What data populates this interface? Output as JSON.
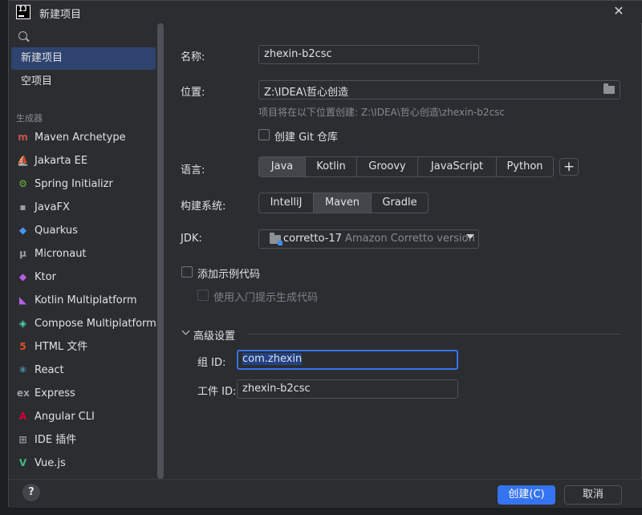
{
  "window": {
    "title": "新建项目"
  },
  "sidebar": {
    "top_items": [
      {
        "label": "新建项目",
        "selected": true
      },
      {
        "label": "空项目",
        "selected": false
      }
    ],
    "group_label": "生成器",
    "generators": [
      {
        "label": "Maven Archetype",
        "icon": "maven-icon",
        "glyph": "m",
        "color": "#c75450"
      },
      {
        "label": "Jakarta EE",
        "icon": "jakarta-icon",
        "glyph": "⛵",
        "color": "#f2a22e"
      },
      {
        "label": "Spring Initializr",
        "icon": "spring-icon",
        "glyph": "⚙",
        "color": "#6db33f"
      },
      {
        "label": "JavaFX",
        "icon": "javafx-icon",
        "glyph": "▪",
        "color": "#9aa0a8"
      },
      {
        "label": "Quarkus",
        "icon": "quarkus-icon",
        "glyph": "◆",
        "color": "#4695eb"
      },
      {
        "label": "Micronaut",
        "icon": "micronaut-icon",
        "glyph": "μ",
        "color": "#9aa0a8"
      },
      {
        "label": "Ktor",
        "icon": "ktor-icon",
        "glyph": "◆",
        "color": "#b95ee8"
      },
      {
        "label": "Kotlin Multiplatform",
        "icon": "kotlin-icon",
        "glyph": "◣",
        "color": "#b95ee8"
      },
      {
        "label": "Compose Multiplatform",
        "icon": "compose-icon",
        "glyph": "◈",
        "color": "#4dd0b0"
      },
      {
        "label": "HTML 文件",
        "icon": "html-icon",
        "glyph": "5",
        "color": "#e44d26"
      },
      {
        "label": "React",
        "icon": "react-icon",
        "glyph": "⚛",
        "color": "#61dafb"
      },
      {
        "label": "Express",
        "icon": "express-icon",
        "glyph": "ex",
        "color": "#9aa0a8"
      },
      {
        "label": "Angular CLI",
        "icon": "angular-icon",
        "glyph": "A",
        "color": "#dd0031"
      },
      {
        "label": "IDE 插件",
        "icon": "plugin-icon",
        "glyph": "⊞",
        "color": "#9aa0a8"
      },
      {
        "label": "Vue.js",
        "icon": "vue-icon",
        "glyph": "V",
        "color": "#42b883"
      }
    ]
  },
  "form": {
    "name_label": "名称:",
    "name_value": "zhexin-b2csc",
    "location_label": "位置:",
    "location_value": "Z:\\IDEA\\哲心创造",
    "location_hint": "项目将在以下位置创建: Z:\\IDEA\\哲心创造\\zhexin-b2csc",
    "git_checkbox_label": "创建 Git 仓库",
    "language_label": "语言:",
    "languages": [
      {
        "label": "Java",
        "selected": true
      },
      {
        "label": "Kotlin",
        "selected": false
      },
      {
        "label": "Groovy",
        "selected": false
      },
      {
        "label": "JavaScript",
        "selected": false
      },
      {
        "label": "Python",
        "selected": false
      }
    ],
    "add_language_label": "+",
    "build_label": "构建系统:",
    "build_systems": [
      {
        "label": "IntelliJ",
        "selected": false
      },
      {
        "label": "Maven",
        "selected": true
      },
      {
        "label": "Gradle",
        "selected": false
      }
    ],
    "jdk_label": "JDK:",
    "jdk_value": "corretto-17",
    "jdk_vendor": "Amazon Corretto version",
    "sample_code_label": "添加示例代码",
    "onboarding_label": "使用入门提示生成代码",
    "advanced_label": "高级设置",
    "group_id_label": "组 ID:",
    "group_id_value": "com.zhexin",
    "artifact_id_label": "工件 ID:",
    "artifact_id_value": "zhexin-b2csc"
  },
  "footer": {
    "help_label": "?",
    "create_label": "创建(C)",
    "cancel_label": "取消"
  },
  "colors": {
    "background": "#2b2d30",
    "selection": "#2e436e",
    "primary": "#3574f0",
    "border": "#4e5157"
  }
}
